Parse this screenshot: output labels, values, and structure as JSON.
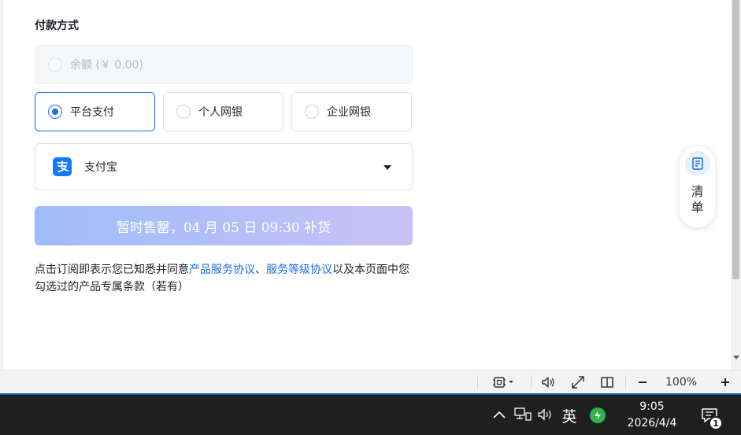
{
  "payment": {
    "section_title": "付款方式",
    "balance_label": "余额 (￥ 0.00)",
    "options": [
      {
        "label": "平台支付",
        "selected": true
      },
      {
        "label": "个人网银",
        "selected": false
      },
      {
        "label": "企业网银",
        "selected": false
      }
    ],
    "channel": {
      "label": "支付宝",
      "icon": "alipay-icon"
    },
    "buy_button_label": "暂时售罄，04 月 05 日 09:30 补货"
  },
  "agreement": {
    "prefix": "点击订阅即表示您已知悉并同意",
    "link1": "产品服务协议",
    "sep": "、",
    "link2": "服务等级协议",
    "suffix": "以及本页面中您勾选过的产品专属条款（若有）"
  },
  "floating_panel": {
    "label": "清单",
    "icon": "list-doc-icon"
  },
  "statusbar": {
    "zoom_label": "100%",
    "icons": [
      "screenshot-icon",
      "speaker-icon",
      "fullscreen-icon",
      "split-view-icon",
      "zoom-out-icon",
      "zoom-in-icon"
    ]
  },
  "taskbar": {
    "ime_label": "英",
    "clock_time": "9:05",
    "clock_date": "2026/4/4",
    "notification_count": "1"
  },
  "colors": {
    "accent": "#1f6ee6",
    "alipay": "#1677ff",
    "button_gradient_start": "#9ebdf8",
    "button_gradient_end": "#c9c1f6"
  }
}
